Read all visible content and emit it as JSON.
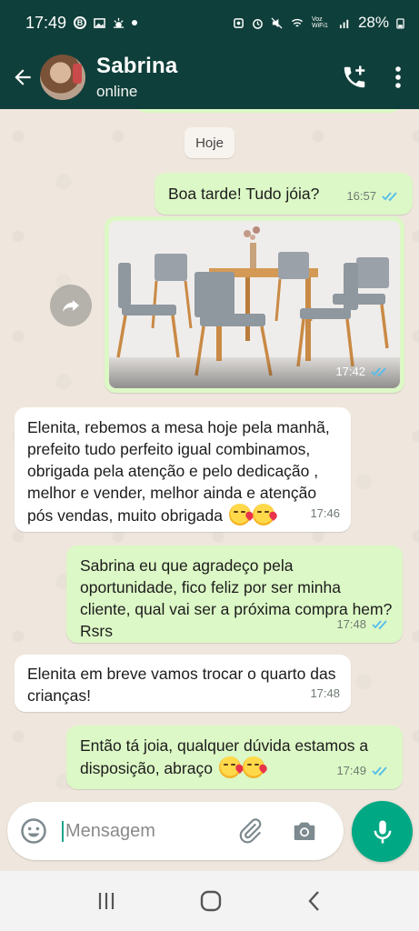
{
  "status_bar": {
    "time": "17:49",
    "battery": "28%",
    "net_label": "Voz WiFi1"
  },
  "header": {
    "contact_name": "Sabrina",
    "contact_status": "online"
  },
  "chat": {
    "day_label": "Hoje",
    "messages": [
      {
        "direction": "out",
        "text": "Boa tarde! Tudo jóia?",
        "time": "16:57",
        "read": true
      },
      {
        "direction": "out",
        "type": "image",
        "time": "17:42",
        "read": true
      },
      {
        "direction": "in",
        "text": "Elenita, rebemos a mesa hoje pela manhã, prefeito tudo perfeito igual combinamos, obrigada pela atenção e pelo dedicação , melhor e vender, melhor ainda e atenção pós vendas, muito obrigada",
        "time": "17:46"
      },
      {
        "direction": "out",
        "text": "Sabrina eu que agradeço pela oportunidade, fico feliz por ser minha cliente,  qual vai ser a próxima compra hem? Rsrs",
        "time": "17:48",
        "read": true
      },
      {
        "direction": "in",
        "text": "Elenita em breve vamos trocar o quarto das crianças!",
        "time": "17:48"
      },
      {
        "direction": "out",
        "text": "Então tá joia,  qualquer dúvida estamos a disposição, abraço",
        "time": "17:49",
        "read": true
      }
    ]
  },
  "composer": {
    "placeholder": "Mensagem"
  },
  "colors": {
    "header": "#0f3f3a",
    "outgoing_bubble": "#dcf8c6",
    "incoming_bubble": "#ffffff",
    "accent": "#00a884",
    "read_ticks": "#53bdeb"
  },
  "icons": [
    "back-arrow-icon",
    "add-call-icon",
    "more-vert-icon",
    "forward-icon",
    "emoji-icon",
    "attach-icon",
    "camera-icon",
    "mic-icon",
    "read-ticks-icon",
    "nav-recents-icon",
    "nav-home-icon",
    "nav-back-icon"
  ]
}
